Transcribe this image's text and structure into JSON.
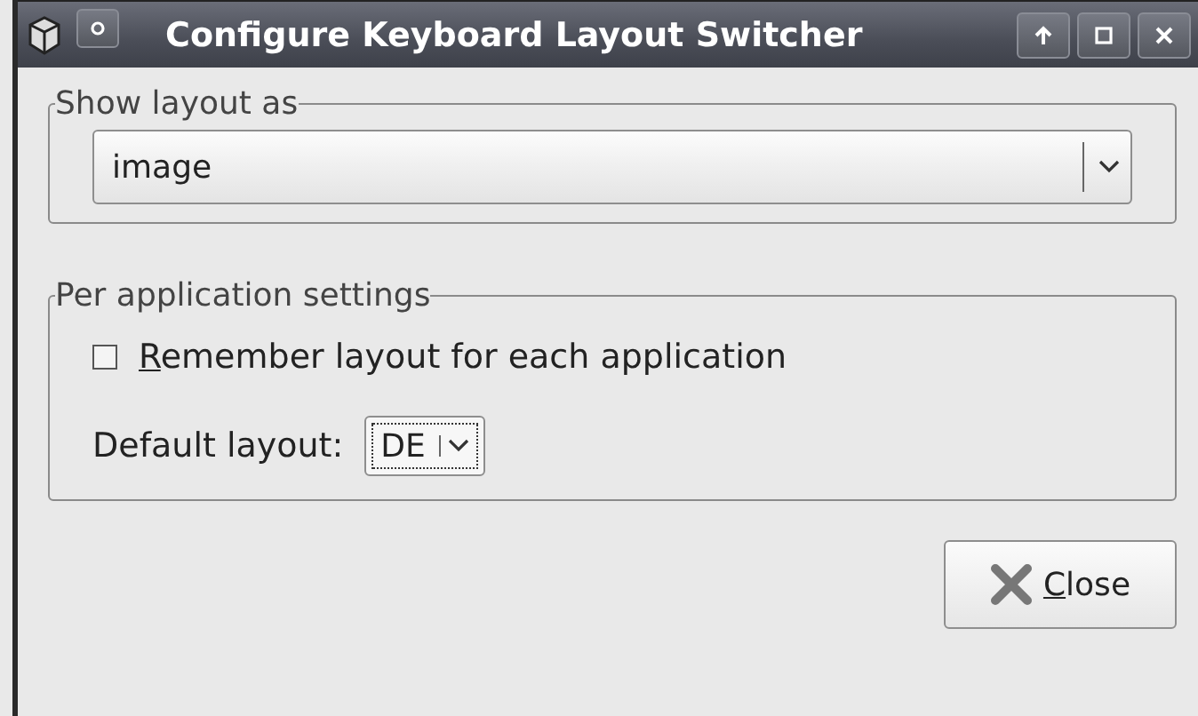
{
  "window": {
    "title": "Configure Keyboard Layout Switcher"
  },
  "show_layout_frame": {
    "label": "Show layout as",
    "dropdown": {
      "value": "image"
    }
  },
  "per_application_frame": {
    "label": "Per application settings",
    "remember_checkbox": {
      "mnemonic": "R",
      "label_rest": "emember layout for each application",
      "checked": false
    },
    "default_layout": {
      "label": "Default layout:",
      "value": "DE",
      "focused": true
    }
  },
  "close_button": {
    "mnemonic": "C",
    "label_rest": "lose"
  }
}
